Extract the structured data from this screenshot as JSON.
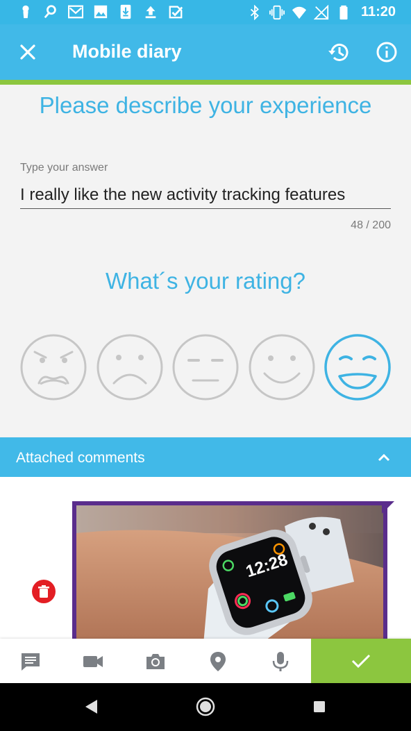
{
  "status_bar": {
    "time": "11:20",
    "left_icons": [
      "keyhole-icon",
      "search-icon",
      "mail-icon",
      "image-icon",
      "download-icon",
      "upload-icon",
      "checkbox-icon"
    ],
    "right_icons": [
      "bluetooth-icon",
      "vibrate-icon",
      "wifi-icon",
      "no-signal-icon",
      "battery-icon"
    ]
  },
  "app_bar": {
    "title": "Mobile diary",
    "accent_color": "#41b9e8",
    "divider_color": "#8cc63f"
  },
  "question": {
    "title": "Please describe your experience",
    "field_label": "Type your answer",
    "answer_value": "I really like the new activity tracking features",
    "counter": "48 / 200"
  },
  "rating": {
    "title": "What´s your rating?",
    "options": [
      "very-angry",
      "sad",
      "neutral",
      "happy",
      "very-happy"
    ],
    "selected": "very-happy",
    "selected_index": 4
  },
  "comments": {
    "header": "Attached comments",
    "expanded": true,
    "attachments": [
      {
        "type": "image",
        "description": "smartwatch on wrist",
        "watch_time": "12:28"
      }
    ]
  },
  "toolbar": {
    "tools": [
      "comment-icon",
      "video-icon",
      "camera-icon",
      "location-icon",
      "microphone-icon"
    ],
    "confirm_color": "#8cc63f"
  },
  "nav_bar": {
    "buttons": [
      "back",
      "home",
      "recents"
    ]
  }
}
